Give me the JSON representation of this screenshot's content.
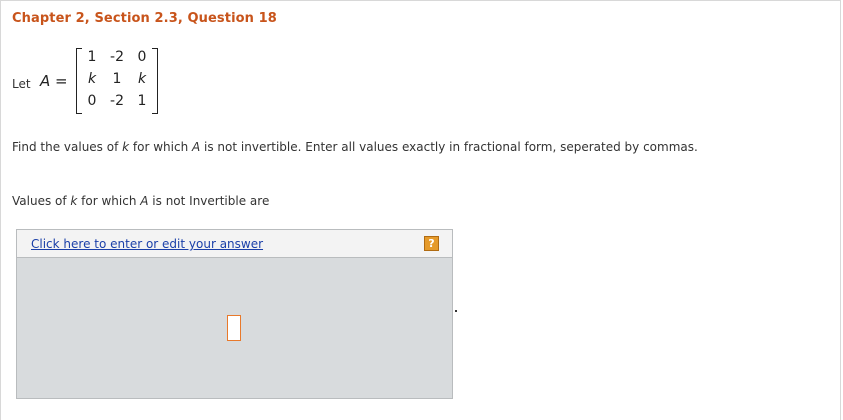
{
  "title": "Chapter 2, Section 2.3, Question 18",
  "problem": {
    "let_label": "Let",
    "matrix_name": "A",
    "equals": "=",
    "matrix": [
      [
        "1",
        "-2",
        "0"
      ],
      [
        "k",
        "1",
        "k"
      ],
      [
        "0",
        "-2",
        "1"
      ]
    ],
    "question_parts": {
      "p1": "Find the values of ",
      "k": "k",
      "p2": " for which ",
      "a": "A",
      "p3": " is not invertible. Enter all values exactly in fractional form, seperated by commas."
    }
  },
  "answer_prompt": {
    "p1": "Values of ",
    "k": "k",
    "p2": " for which ",
    "a": "A",
    "p3": " is not Invertible are"
  },
  "answer_panel": {
    "link_text": "Click here to enter or edit your answer",
    "help_symbol": "?",
    "help_color": "#e59a2a",
    "placeholder_color": "#e8792b"
  },
  "colors": {
    "title": "#c8541b",
    "link": "#1a3fa8",
    "panel_bg": "#d8dbdd"
  }
}
